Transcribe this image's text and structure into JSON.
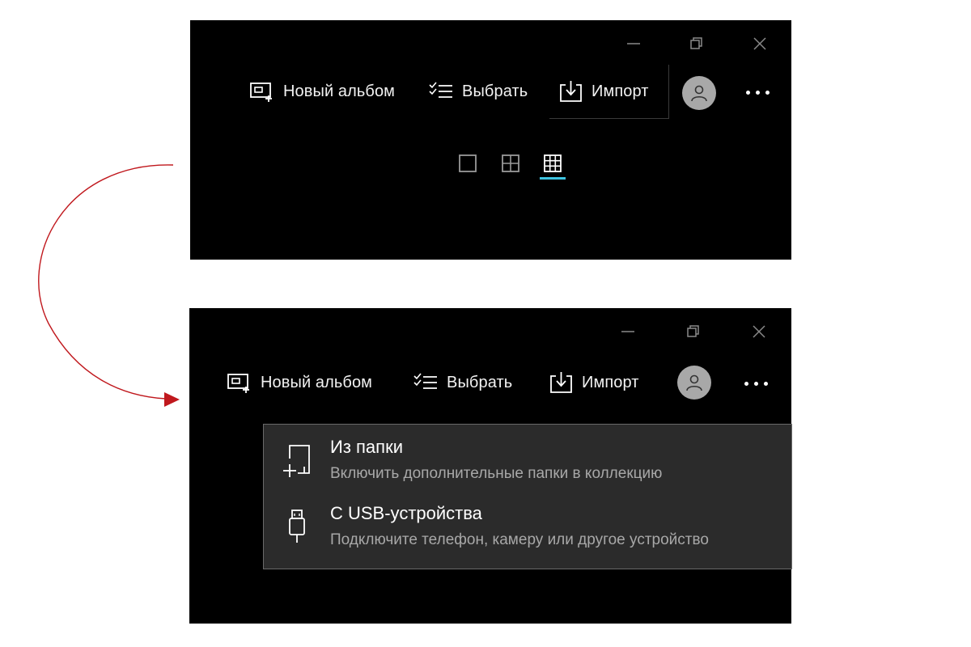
{
  "toolbar": {
    "new_album_label": "Новый альбом",
    "select_label": "Выбрать",
    "import_label": "Импорт"
  },
  "import_menu": {
    "items": [
      {
        "title": "Из папки",
        "subtitle": "Включить дополнительные папки в коллекцию",
        "icon": "folder-add-icon"
      },
      {
        "title": "С USB-устройства",
        "subtitle": "Подключите телефон, камеру или другое устройство",
        "icon": "usb-icon"
      }
    ]
  },
  "view_modes": [
    "single-view-icon",
    "grid-4-view-icon",
    "grid-9-view-icon"
  ],
  "selected_view_mode": "grid-9-view-icon",
  "colors": {
    "background": "#000000",
    "accent": "#3ec3e0",
    "menu_background": "#2b2b2b",
    "avatar": "#a8a8a8",
    "arrow": "#c0181d",
    "subtext": "#a8a8a8"
  }
}
